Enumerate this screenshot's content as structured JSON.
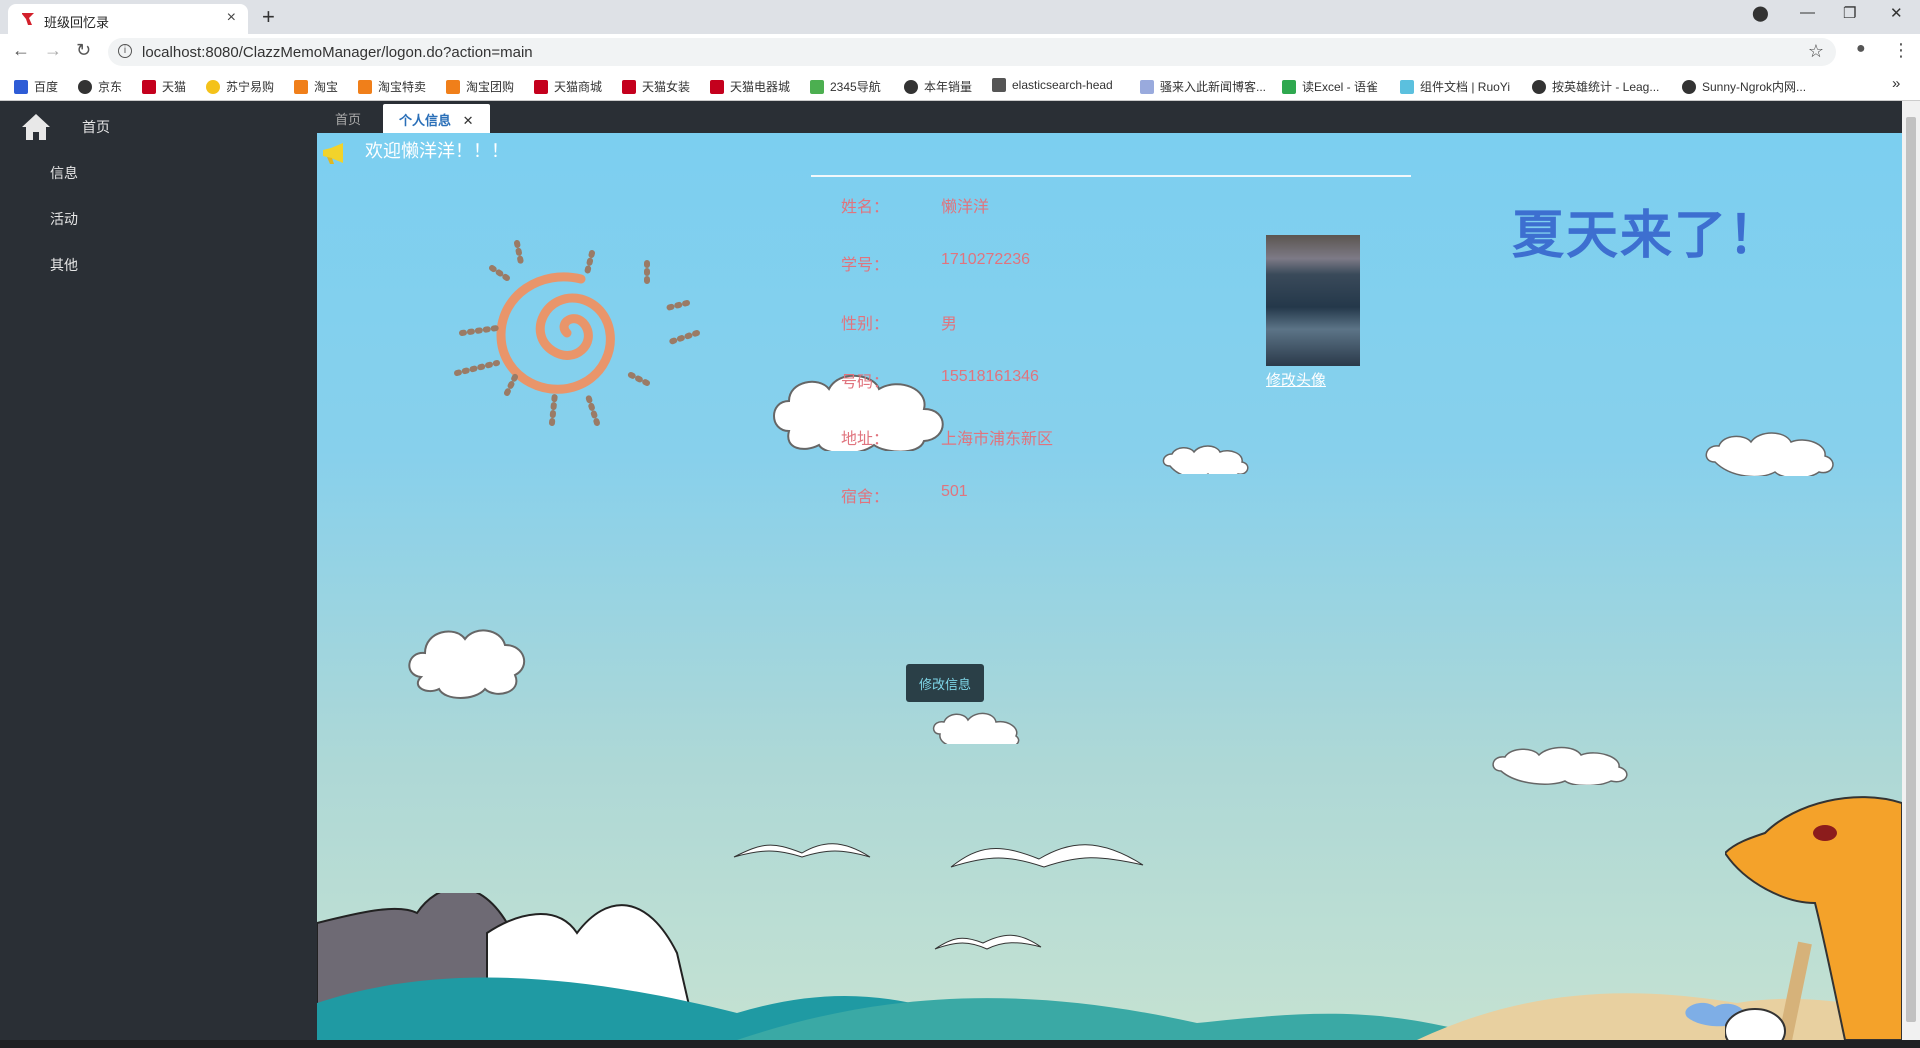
{
  "browser": {
    "tab_title": "班级回忆录",
    "url": "localhost:8080/ClazzMemoManager/logon.do?action=main",
    "bookmarks": [
      "百度",
      "京东",
      "天猫",
      "苏宁易购",
      "淘宝",
      "淘宝特卖",
      "淘宝团购",
      "天猫商城",
      "天猫女装",
      "天猫电器城",
      "2345导航",
      "本年销量",
      "elasticsearch-head",
      "骚来入此新闻博客...",
      "读Excel - 语雀",
      "组件文档 | RuoYi",
      "按英雄统计 - Leag...",
      "Sunny-Ngrok内网..."
    ],
    "more_bookmarks": "»"
  },
  "sidebar": {
    "home_label": "首页",
    "items": [
      {
        "label": "信息"
      },
      {
        "label": "活动"
      },
      {
        "label": "其他"
      }
    ]
  },
  "content_tabs": {
    "home": "首页",
    "active": "个人信息",
    "close": "✕"
  },
  "page": {
    "welcome": "欢迎懒洋洋！！！",
    "summer_text": "夏天来了！",
    "fields": [
      {
        "label": "姓名：",
        "value": "懒洋洋"
      },
      {
        "label": "学号：",
        "value": "1710272236"
      },
      {
        "label": "性别：",
        "value": "男"
      },
      {
        "label": "号码：",
        "value": "15518161346"
      },
      {
        "label": "地址：",
        "value": "上海市浦东新区"
      },
      {
        "label": "宿舍：",
        "value": "501"
      }
    ],
    "avatar_link": "修改头像",
    "edit_button": "修改信息"
  },
  "colors": {
    "sidebar": "#2a2f35",
    "field_text": "#e0747e",
    "sky": "#7ccff0",
    "button": "#2a3f47"
  }
}
